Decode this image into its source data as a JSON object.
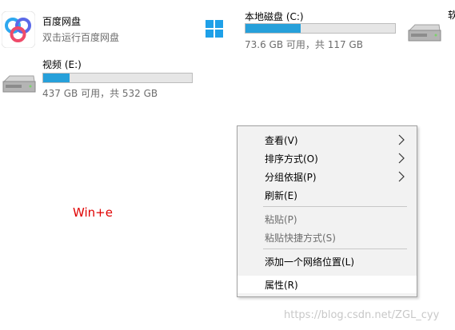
{
  "items": [
    {
      "name": "百度网盘",
      "sub": "双击运行百度网盘"
    },
    {
      "name": "本地磁盘 (C:)",
      "usage": "73.6 GB 可用，共 117 GB",
      "used_fraction": 0.371
    },
    {
      "name": "视频 (E:)",
      "usage": "437 GB 可用，共 532 GB",
      "used_fraction": 0.179
    }
  ],
  "partial_label": "软",
  "context_menu": {
    "items": [
      {
        "label": "查看(V)",
        "submenu": true,
        "enabled": true
      },
      {
        "label": "排序方式(O)",
        "submenu": true,
        "enabled": true
      },
      {
        "label": "分组依据(P)",
        "submenu": true,
        "enabled": true
      },
      {
        "label": "刷新(E)",
        "submenu": false,
        "enabled": true
      },
      {
        "label": "粘贴(P)",
        "submenu": false,
        "enabled": false
      },
      {
        "label": "粘贴快捷方式(S)",
        "submenu": false,
        "enabled": false
      },
      {
        "label": "添加一个网络位置(L)",
        "submenu": false,
        "enabled": true
      },
      {
        "label": "属性(R)",
        "submenu": false,
        "enabled": true,
        "highlighted": true
      }
    ]
  },
  "hint": "Win+e",
  "watermark": "https://blog.csdn.net/ZGL_cyy",
  "colors": {
    "progress_fill": "#26a0da",
    "hint_text": "#e00000",
    "menu_bg": "#f2f2f2"
  }
}
